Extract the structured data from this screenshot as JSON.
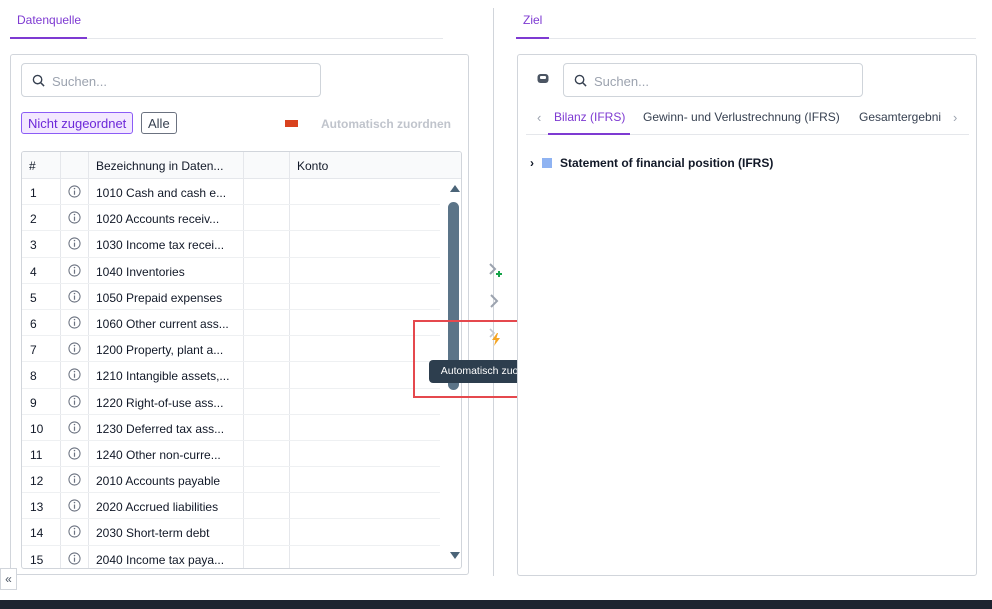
{
  "left_tab": {
    "label": "Datenquelle"
  },
  "right_tab": {
    "label": "Ziel"
  },
  "source": {
    "search_placeholder": "Suchen...",
    "filter_chips": [
      "Nicht zugeordnet",
      "Alle"
    ],
    "auto_assign_label": "Automatisch zuordnen",
    "columns": [
      "#",
      "Bezeichnung in Daten...",
      "Konto"
    ],
    "rows": [
      {
        "num": "1",
        "label": "1010 Cash and cash e..."
      },
      {
        "num": "2",
        "label": "1020 Accounts receiv..."
      },
      {
        "num": "3",
        "label": "1030 Income tax recei..."
      },
      {
        "num": "4",
        "label": "1040 Inventories"
      },
      {
        "num": "5",
        "label": "1050 Prepaid expenses"
      },
      {
        "num": "6",
        "label": "1060 Other current ass..."
      },
      {
        "num": "7",
        "label": "1200 Property, plant a..."
      },
      {
        "num": "8",
        "label": "1210 Intangible assets,..."
      },
      {
        "num": "9",
        "label": "1220 Right-of-use ass..."
      },
      {
        "num": "10",
        "label": "1230 Deferred tax ass..."
      },
      {
        "num": "11",
        "label": "1240 Other non-curre..."
      },
      {
        "num": "12",
        "label": "2010 Accounts payable"
      },
      {
        "num": "13",
        "label": "2020 Accrued liabilities"
      },
      {
        "num": "14",
        "label": "2030 Short-term debt"
      },
      {
        "num": "15",
        "label": "2040 Income tax paya..."
      }
    ]
  },
  "middle": {
    "actions": [
      "map-add-icon",
      "map-icon",
      "auto-map-icon"
    ],
    "tooltip": "Automatisch zuordnen"
  },
  "target": {
    "search_placeholder": "Suchen...",
    "tabs": [
      "Bilanz (IFRS)",
      "Gewinn- und Verlustrechnung (IFRS)",
      "Gesamtergebni"
    ],
    "tree_root": "Statement of financial position (IFRS)"
  },
  "collapse_label": "«",
  "colors": {
    "accent": "#7e3ad2",
    "highlight": "#e5484d",
    "tooltip_bg": "#2d3e4e"
  }
}
